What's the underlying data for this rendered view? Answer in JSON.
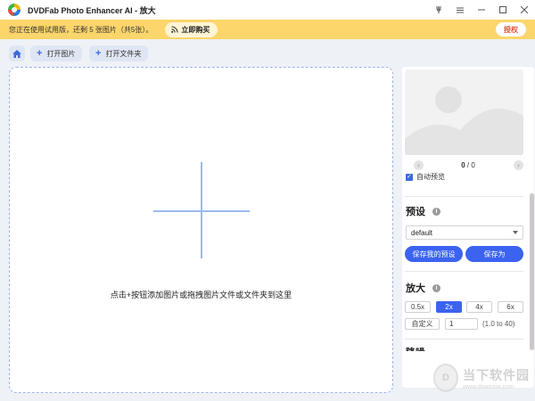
{
  "window": {
    "title": "DVDFab Photo Enhancer AI - 放大",
    "controls": [
      "pin-icon",
      "menu-icon",
      "minimize-icon",
      "maximize-icon",
      "close-icon"
    ]
  },
  "banner": {
    "text": "您正在使用试用版，还剩 5 张图片（共5张）。",
    "buy_label": "立即购买",
    "auth_label": "授权"
  },
  "toolbar": {
    "open_image": "打开图片",
    "open_folder": "打开文件夹"
  },
  "dropzone": {
    "hint": "点击+按钮添加图片或拖拽图片文件或文件夹到这里"
  },
  "panel": {
    "counter_current": "0",
    "counter_sep": " / ",
    "counter_total": "0",
    "auto_preview": "自动预览",
    "preset": {
      "title": "预设",
      "selected": "default",
      "save_my_preset": "保存我的预设",
      "save_as": "保存为"
    },
    "scale": {
      "title": "放大",
      "options": [
        "0.5x",
        "2x",
        "4x",
        "6x"
      ],
      "active_index": 1,
      "custom_label": "自定义",
      "custom_value": "1",
      "range_hint": "(1.0 to 40)"
    },
    "next_section_title": "降噪"
  },
  "watermark": {
    "name": "当下软件园",
    "url": "www.downxia.com"
  },
  "colors": {
    "accent": "#3b63f0",
    "banner": "#fcd56b",
    "auth_text": "#e0533a"
  }
}
